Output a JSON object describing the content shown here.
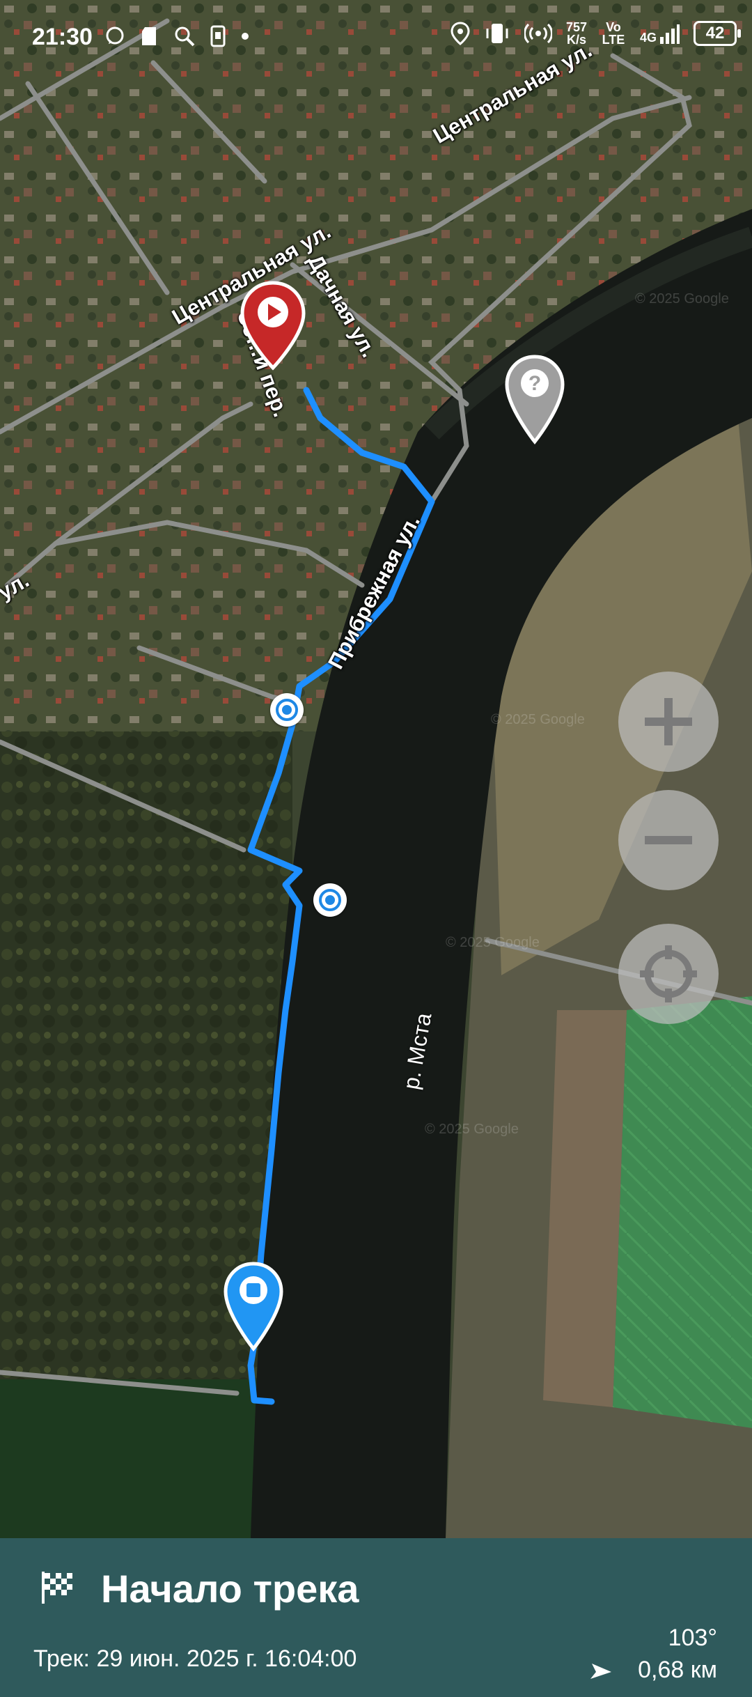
{
  "status_bar": {
    "time": "21:30",
    "left_icons": [
      "whatsapp-icon",
      "sd-card-icon",
      "search-icon",
      "phone-icon",
      "dot-icon"
    ],
    "right_icons": [
      "location-icon",
      "vibrate-icon",
      "hotspot-icon"
    ],
    "net_speed": "757",
    "net_speed_unit": "K/s",
    "volte": "Vo LTE",
    "network": "4G",
    "battery": "42"
  },
  "map": {
    "streets": [
      "Центральная ул.",
      "Центральная ул.",
      "Дачная ул.",
      "Зе…й пер.",
      "Прибрежная ул.",
      "ул."
    ],
    "river": "р. Мста",
    "watermark": "© 2025 Google",
    "colors": {
      "track": "#1e8fff",
      "start_marker": "#c62828",
      "end_marker": "#2196f3",
      "unknown_marker": "#9e9e9e"
    }
  },
  "controls": {
    "zoom_in": "+",
    "zoom_out": "−",
    "locate": "locate-icon"
  },
  "panel": {
    "title": "Начало трека",
    "subtitle": "Трек: 29 июн. 2025 г. 16:04:00",
    "bearing": "103°",
    "distance": "0,68 км"
  }
}
